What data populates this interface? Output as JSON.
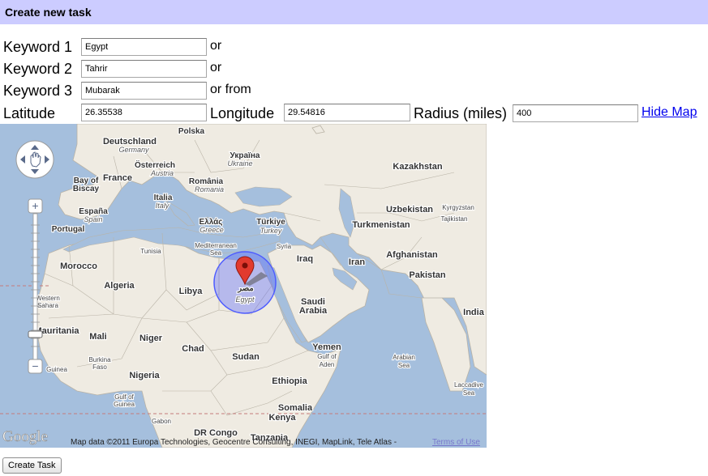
{
  "header": {
    "title": "Create new task"
  },
  "form": {
    "keyword1": {
      "label": "Keyword 1",
      "value": "Egypt",
      "suffix": "or"
    },
    "keyword2": {
      "label": "Keyword 2",
      "value": "Tahrir",
      "suffix": "or"
    },
    "keyword3": {
      "label": "Keyword 3",
      "value": "Mubarak",
      "suffix": "or from"
    },
    "latitude": {
      "label": "Latitude",
      "value": "26.35538"
    },
    "longitude": {
      "label": "Longitude",
      "value": "29.54816"
    },
    "radius": {
      "label": "Radius (miles)",
      "value": "400"
    },
    "toggle_map_label": "Hide Map"
  },
  "map": {
    "labels": [
      {
        "text": "Polska",
        "cls": "small"
      },
      {
        "text": "Deutschland",
        "cls": "country"
      },
      {
        "text": "Germany",
        "cls": "italic"
      },
      {
        "text": "Україна",
        "cls": "small"
      },
      {
        "text": "Ukraine",
        "cls": "italic"
      },
      {
        "text": "Kazakhstan",
        "cls": "country"
      },
      {
        "text": "Österreich",
        "cls": "small"
      },
      {
        "text": "Austria",
        "cls": "italic"
      },
      {
        "text": "România",
        "cls": "small"
      },
      {
        "text": "Romania",
        "cls": "italic"
      },
      {
        "text": "France",
        "cls": "country"
      },
      {
        "text": "Bay of",
        "cls": "small"
      },
      {
        "text": "Biscay",
        "cls": "small"
      },
      {
        "text": "Italia",
        "cls": "small"
      },
      {
        "text": "Italy",
        "cls": "italic"
      },
      {
        "text": "Uzbekistan",
        "cls": "country"
      },
      {
        "text": "Kyrgyzstan",
        "cls": "tiny"
      },
      {
        "text": "España",
        "cls": "small"
      },
      {
        "text": "Spain",
        "cls": "italic"
      },
      {
        "text": "Portugal",
        "cls": "small"
      },
      {
        "text": "Ελλάς",
        "cls": "small"
      },
      {
        "text": "Greece",
        "cls": "italic"
      },
      {
        "text": "Türkiye",
        "cls": "small"
      },
      {
        "text": "Turkey",
        "cls": "italic"
      },
      {
        "text": "Turkmenistan",
        "cls": "country"
      },
      {
        "text": "Tajikistan",
        "cls": "tiny"
      },
      {
        "text": "Mediterranean",
        "cls": "tiny"
      },
      {
        "text": "Sea",
        "cls": "tiny"
      },
      {
        "text": "Tunisia",
        "cls": "tiny"
      },
      {
        "text": "Syria",
        "cls": "tiny"
      },
      {
        "text": "Afghanistan",
        "cls": "country"
      },
      {
        "text": "Morocco",
        "cls": "country"
      },
      {
        "text": "Iraq",
        "cls": "country"
      },
      {
        "text": "Iran",
        "cls": "country"
      },
      {
        "text": "Pakistan",
        "cls": "country"
      },
      {
        "text": "Algeria",
        "cls": "country"
      },
      {
        "text": "Libya",
        "cls": "country"
      },
      {
        "text": "مصر",
        "cls": "small"
      },
      {
        "text": "Egypt",
        "cls": "italic"
      },
      {
        "text": "Saudi",
        "cls": "country"
      },
      {
        "text": "Arabia",
        "cls": "country"
      },
      {
        "text": "India",
        "cls": "country"
      },
      {
        "text": "Western",
        "cls": "tiny"
      },
      {
        "text": "Sahara",
        "cls": "tiny"
      },
      {
        "text": "Mauritania",
        "cls": "country"
      },
      {
        "text": "Mali",
        "cls": "country"
      },
      {
        "text": "Niger",
        "cls": "country"
      },
      {
        "text": "Chad",
        "cls": "country"
      },
      {
        "text": "Sudan",
        "cls": "country"
      },
      {
        "text": "Yemen",
        "cls": "country"
      },
      {
        "text": "Gulf of",
        "cls": "tiny"
      },
      {
        "text": "Aden",
        "cls": "tiny"
      },
      {
        "text": "Arabian",
        "cls": "tiny"
      },
      {
        "text": "Sea",
        "cls": "tiny"
      },
      {
        "text": "Burkina",
        "cls": "tiny"
      },
      {
        "text": "Faso",
        "cls": "tiny"
      },
      {
        "text": "Guinea",
        "cls": "tiny"
      },
      {
        "text": "Nigeria",
        "cls": "country"
      },
      {
        "text": "Ethiopia",
        "cls": "country"
      },
      {
        "text": "Laccadive",
        "cls": "tiny"
      },
      {
        "text": "Sea",
        "cls": "tiny"
      },
      {
        "text": "Gulf of",
        "cls": "tiny"
      },
      {
        "text": "Guinea",
        "cls": "tiny"
      },
      {
        "text": "Somalia",
        "cls": "country"
      },
      {
        "text": "Gabon",
        "cls": "tiny"
      },
      {
        "text": "Kenya",
        "cls": "country"
      },
      {
        "text": "DR Congo",
        "cls": "country"
      },
      {
        "text": "Tanzania",
        "cls": "country"
      }
    ],
    "google_logo": "Google",
    "attribution": "Map data ©2011 Europa Technologies, Geocentre Consulting, INEGI, MapLink, Tele Atlas -",
    "terms_link": "Terms of Use",
    "colors": {
      "sea": "#a5bfdd",
      "land": "#efebe2",
      "radius": "#4d5bff",
      "marker": "#e23a2e"
    }
  },
  "actions": {
    "create_label": "Create Task"
  }
}
